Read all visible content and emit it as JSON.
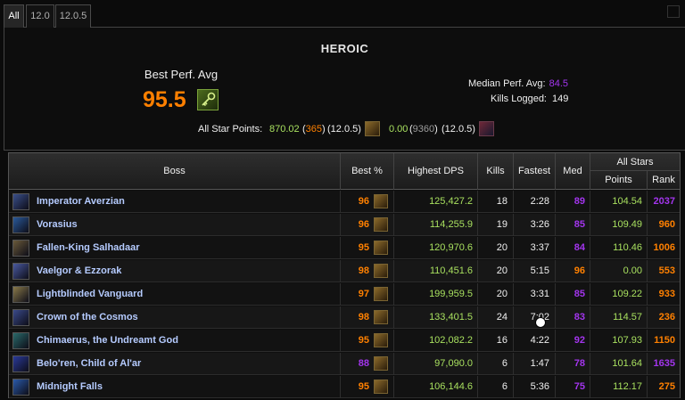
{
  "tabs": [
    {
      "label": "All",
      "active": true
    },
    {
      "label": "12.0",
      "active": false
    },
    {
      "label": "12.0.5",
      "active": false
    }
  ],
  "summary": {
    "difficulty": "HEROIC",
    "best_perf_label": "Best Perf. Avg",
    "best_perf_value": "95.5",
    "best_perf_icon": "key-icon",
    "median_label": "Median Perf. Avg:",
    "median_value": "84.5",
    "kills_label": "Kills Logged:",
    "kills_value": "149",
    "all_star_label": "All Star Points:",
    "all_star_1_points": "870.02",
    "all_star_1_rank": "365",
    "all_star_1_patch": "(12.0.5)",
    "all_star_2_points": "0.00",
    "all_star_2_rank": "9360",
    "all_star_2_patch": "(12.0.5)"
  },
  "table": {
    "headers": {
      "boss": "Boss",
      "best": "Best %",
      "dps": "Highest DPS",
      "kills": "Kills",
      "fastest": "Fastest",
      "med": "Med",
      "all_stars": "All Stars",
      "points": "Points",
      "rank": "Rank"
    },
    "rows": [
      {
        "boss": "Imperator Averzian",
        "best": "96",
        "best_q": "orange",
        "dps": "125,427.2",
        "kills": "18",
        "fastest": "2:28",
        "med": "89",
        "med_q": "purple",
        "points": "104.54",
        "rank": "2037",
        "rank_q": "purple",
        "icon_color": "#3a4f8a"
      },
      {
        "boss": "Vorasius",
        "best": "96",
        "best_q": "orange",
        "dps": "114,255.9",
        "kills": "19",
        "fastest": "3:26",
        "med": "85",
        "med_q": "purple",
        "points": "109.49",
        "rank": "960",
        "rank_q": "orange",
        "icon_color": "#2a5a9a"
      },
      {
        "boss": "Fallen-King Salhadaar",
        "best": "95",
        "best_q": "orange",
        "dps": "120,970.6",
        "kills": "20",
        "fastest": "3:37",
        "med": "84",
        "med_q": "purple",
        "points": "110.46",
        "rank": "1006",
        "rank_q": "orange",
        "icon_color": "#6a5a3a"
      },
      {
        "boss": "Vaelgor & Ezzorak",
        "best": "98",
        "best_q": "orange",
        "dps": "110,451.6",
        "kills": "20",
        "fastest": "5:15",
        "med": "96",
        "med_q": "orange",
        "points": "0.00",
        "rank": "553",
        "rank_q": "orange",
        "icon_color": "#4a5aa0"
      },
      {
        "boss": "Lightblinded Vanguard",
        "best": "97",
        "best_q": "orange",
        "dps": "199,959.5",
        "kills": "20",
        "fastest": "3:31",
        "med": "85",
        "med_q": "purple",
        "points": "109.22",
        "rank": "933",
        "rank_q": "orange",
        "icon_color": "#8a7a4a"
      },
      {
        "boss": "Crown of the Cosmos",
        "best": "98",
        "best_q": "orange",
        "dps": "133,401.5",
        "kills": "24",
        "fastest": "7:02",
        "med": "83",
        "med_q": "purple",
        "points": "114.57",
        "rank": "236",
        "rank_q": "orange",
        "icon_color": "#3a4a8a"
      },
      {
        "boss": "Chimaerus, the Undreamt God",
        "best": "95",
        "best_q": "orange",
        "dps": "102,082.2",
        "kills": "16",
        "fastest": "4:22",
        "med": "92",
        "med_q": "purple",
        "points": "107.93",
        "rank": "1150",
        "rank_q": "orange",
        "icon_color": "#2a6a6a"
      },
      {
        "boss": "Belo'ren, Child of Al'ar",
        "best": "88",
        "best_q": "purple",
        "dps": "97,090.0",
        "kills": "6",
        "fastest": "1:47",
        "med": "78",
        "med_q": "purple",
        "points": "101.64",
        "rank": "1635",
        "rank_q": "purple",
        "icon_color": "#2a3a9a"
      },
      {
        "boss": "Midnight Falls",
        "best": "95",
        "best_q": "orange",
        "dps": "106,144.6",
        "kills": "6",
        "fastest": "5:36",
        "med": "75",
        "med_q": "purple",
        "points": "112.17",
        "rank": "275",
        "rank_q": "orange",
        "icon_color": "#2a5aaa"
      }
    ]
  },
  "colors": {
    "orange": "#ff8000",
    "purple": "#a335ee",
    "green": "#a8e05f",
    "boss_name": "#b5cbff"
  }
}
